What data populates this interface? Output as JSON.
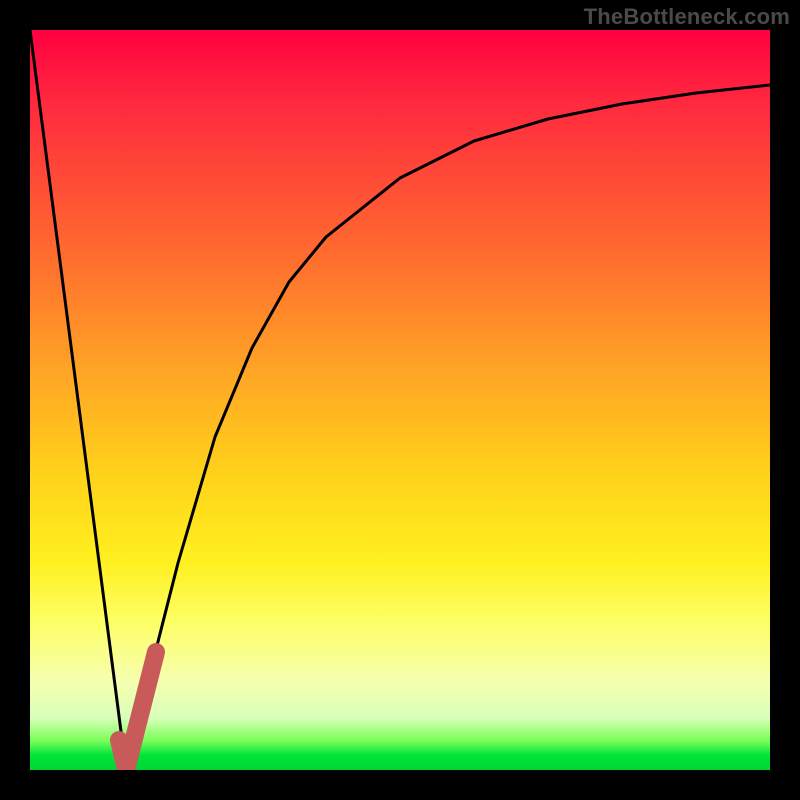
{
  "watermark": "TheBottleneck.com",
  "colors": {
    "page_bg": "#000000",
    "watermark_text": "#4a4a4a",
    "curve_stroke": "#000000",
    "marker_stroke": "#c85a5a"
  },
  "chart_data": {
    "type": "line",
    "title": "",
    "xlabel": "",
    "ylabel": "",
    "xlim": [
      0,
      100
    ],
    "ylim": [
      0,
      100
    ],
    "grid": false,
    "series": [
      {
        "name": "left-branch",
        "x": [
          0,
          13
        ],
        "y": [
          100,
          0
        ]
      },
      {
        "name": "right-branch",
        "x": [
          13,
          16,
          20,
          25,
          30,
          35,
          40,
          50,
          60,
          70,
          80,
          90,
          100
        ],
        "y": [
          0,
          12,
          28,
          45,
          57,
          66,
          72,
          80,
          85,
          88,
          90,
          91.5,
          92.5
        ]
      }
    ],
    "marker": {
      "name": "highlight-J",
      "points_xy": [
        [
          12,
          4
        ],
        [
          13,
          0
        ],
        [
          17,
          16
        ]
      ]
    },
    "background_gradient": {
      "top_color": "#ff0040",
      "bottom_color": "#00d534",
      "description": "vertical red-to-green gradient with thin green band at bottom"
    }
  }
}
